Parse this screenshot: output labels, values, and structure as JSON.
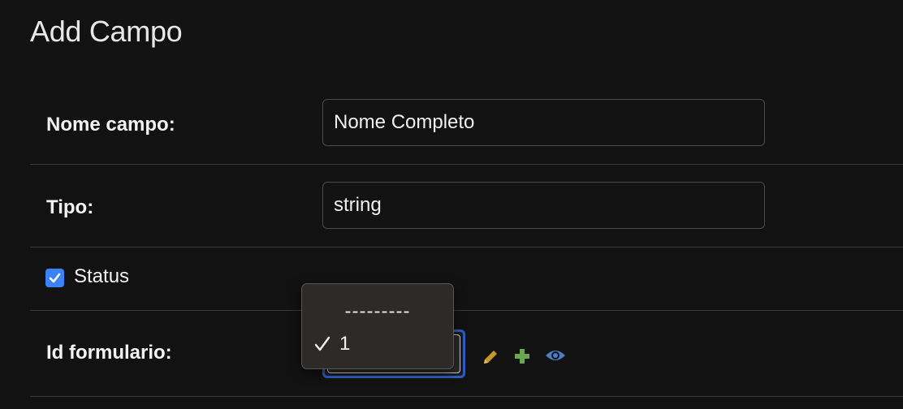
{
  "page": {
    "title": "Add Campo"
  },
  "fields": {
    "nome_campo": {
      "label": "Nome campo:",
      "value": "Nome Completo"
    },
    "tipo": {
      "label": "Tipo:",
      "value": "string"
    },
    "status": {
      "label": "Status",
      "checked": true
    },
    "id_formulario": {
      "label": "Id formulario:",
      "selected": "1",
      "options": [
        "---------",
        "1"
      ]
    }
  },
  "icons": {
    "edit": "pencil-icon",
    "add": "plus-icon",
    "view": "eye-icon"
  },
  "colors": {
    "background": "#121212",
    "checkbox": "#3b82f6",
    "pencil": "#c8962a",
    "plus": "#6aa84f",
    "eye": "#4a7ec8",
    "focus": "#2c5fc0"
  }
}
